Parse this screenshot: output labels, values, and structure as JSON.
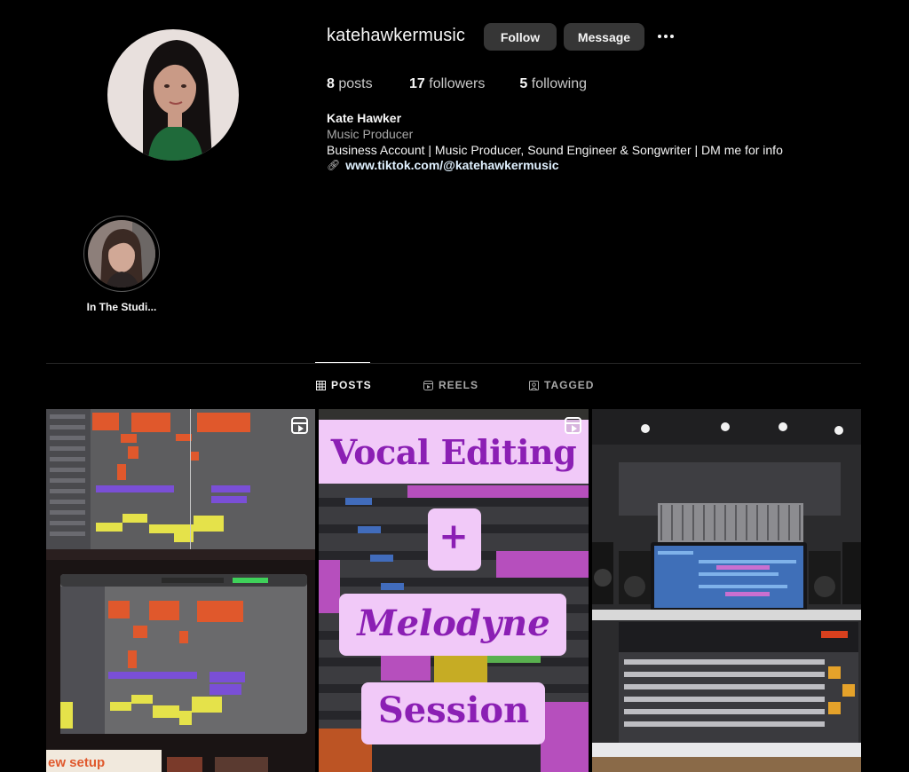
{
  "profile": {
    "username": "katehawkermusic",
    "follow_label": "Follow",
    "message_label": "Message",
    "more_icon": "more-options-icon",
    "stats": {
      "posts_count": "8",
      "posts_label": "posts",
      "followers_count": "17",
      "followers_label": "followers",
      "following_count": "5",
      "following_label": "following"
    },
    "full_name": "Kate Hawker",
    "category": "Music Producer",
    "bio": "Business Account | Music Producer, Sound Engineer & Songwriter | DM me for info",
    "link": "www.tiktok.com/@katehawkermusic",
    "link_icon": "link-icon"
  },
  "highlights": [
    {
      "label": "In The Studi..."
    }
  ],
  "tabs": [
    {
      "label": "POSTS",
      "icon": "grid-icon",
      "active": true
    },
    {
      "label": "REELS",
      "icon": "reels-icon",
      "active": false
    },
    {
      "label": "TAGGED",
      "icon": "tagged-icon",
      "active": false
    }
  ],
  "posts": [
    {
      "kind": "reel",
      "overlay_text": [
        "ew setup"
      ]
    },
    {
      "kind": "reel",
      "overlay_text": [
        "Vocal Editing",
        "+",
        "Melodyne",
        "Session"
      ]
    },
    {
      "kind": "image"
    }
  ],
  "colors": {
    "background": "#000000",
    "button": "#363636",
    "muted_text": "#a8a8a8",
    "link_text": "#e0f1ff",
    "overlay_box": "#f1c9f8",
    "overlay_text": "#8b1fb4"
  }
}
